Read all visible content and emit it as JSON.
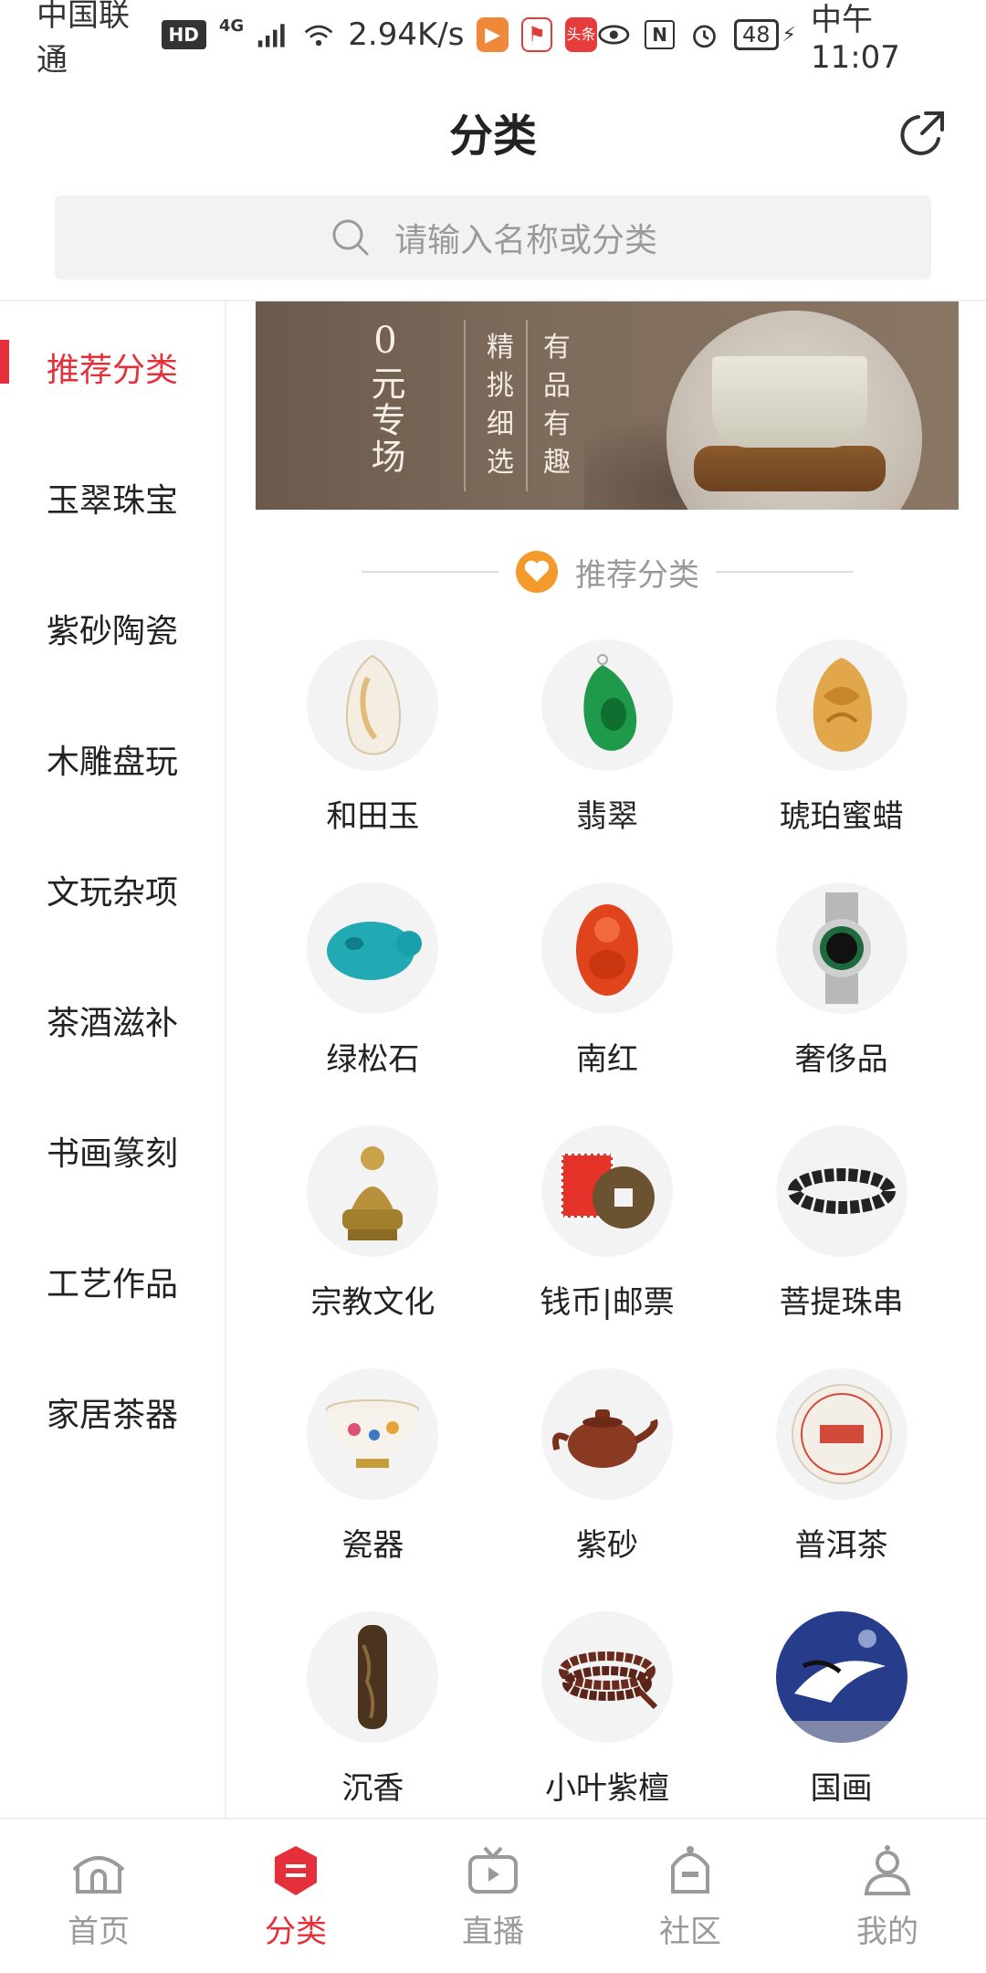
{
  "status_bar": {
    "carrier": "中国联通",
    "hd": "HD",
    "network": "4G",
    "speed": "2.94K/s",
    "app_badge": "头条",
    "nfc": "N",
    "battery": "48",
    "time": "中午11:07"
  },
  "header": {
    "title": "分类",
    "share_icon": "share-icon"
  },
  "search": {
    "placeholder": "请输入名称或分类"
  },
  "sidebar": {
    "items": [
      {
        "label": "推荐分类",
        "active": true
      },
      {
        "label": "玉翠珠宝"
      },
      {
        "label": "紫砂陶瓷"
      },
      {
        "label": "木雕盘玩"
      },
      {
        "label": "文玩杂项"
      },
      {
        "label": "茶酒滋补"
      },
      {
        "label": "书画篆刻"
      },
      {
        "label": "工艺作品"
      },
      {
        "label": "家居茶器"
      }
    ]
  },
  "banner": {
    "zero": "0",
    "title_vertical": "元专场",
    "col1": "精挑细选",
    "col2": "有品有趣"
  },
  "section": {
    "title": "推荐分类"
  },
  "categories": [
    {
      "name": "和田玉",
      "icon": "jade-pebble"
    },
    {
      "name": "翡翠",
      "icon": "jadeite-pendant"
    },
    {
      "name": "琥珀蜜蜡",
      "icon": "amber"
    },
    {
      "name": "绿松石",
      "icon": "turquoise"
    },
    {
      "name": "南红",
      "icon": "south-red-agate"
    },
    {
      "name": "奢侈品",
      "icon": "watch"
    },
    {
      "name": "宗教文化",
      "icon": "buddha-statue"
    },
    {
      "name": "钱币|邮票",
      "icon": "coin-stamp"
    },
    {
      "name": "菩提珠串",
      "icon": "bead-bracelet"
    },
    {
      "name": "瓷器",
      "icon": "porcelain-bowl"
    },
    {
      "name": "紫砂",
      "icon": "teapot"
    },
    {
      "name": "普洱茶",
      "icon": "puer-cake"
    },
    {
      "name": "沉香",
      "icon": "agarwood"
    },
    {
      "name": "小叶紫檀",
      "icon": "sandalwood-beads"
    },
    {
      "name": "国画",
      "icon": "chinese-painting"
    }
  ],
  "tabbar": {
    "items": [
      {
        "label": "首页",
        "icon": "home-icon"
      },
      {
        "label": "分类",
        "icon": "category-icon",
        "active": true
      },
      {
        "label": "直播",
        "icon": "live-tv-icon"
      },
      {
        "label": "社区",
        "icon": "community-icon"
      },
      {
        "label": "我的",
        "icon": "profile-icon"
      }
    ]
  },
  "colors": {
    "accent": "#e5303b",
    "muted": "#9a9a9a"
  }
}
